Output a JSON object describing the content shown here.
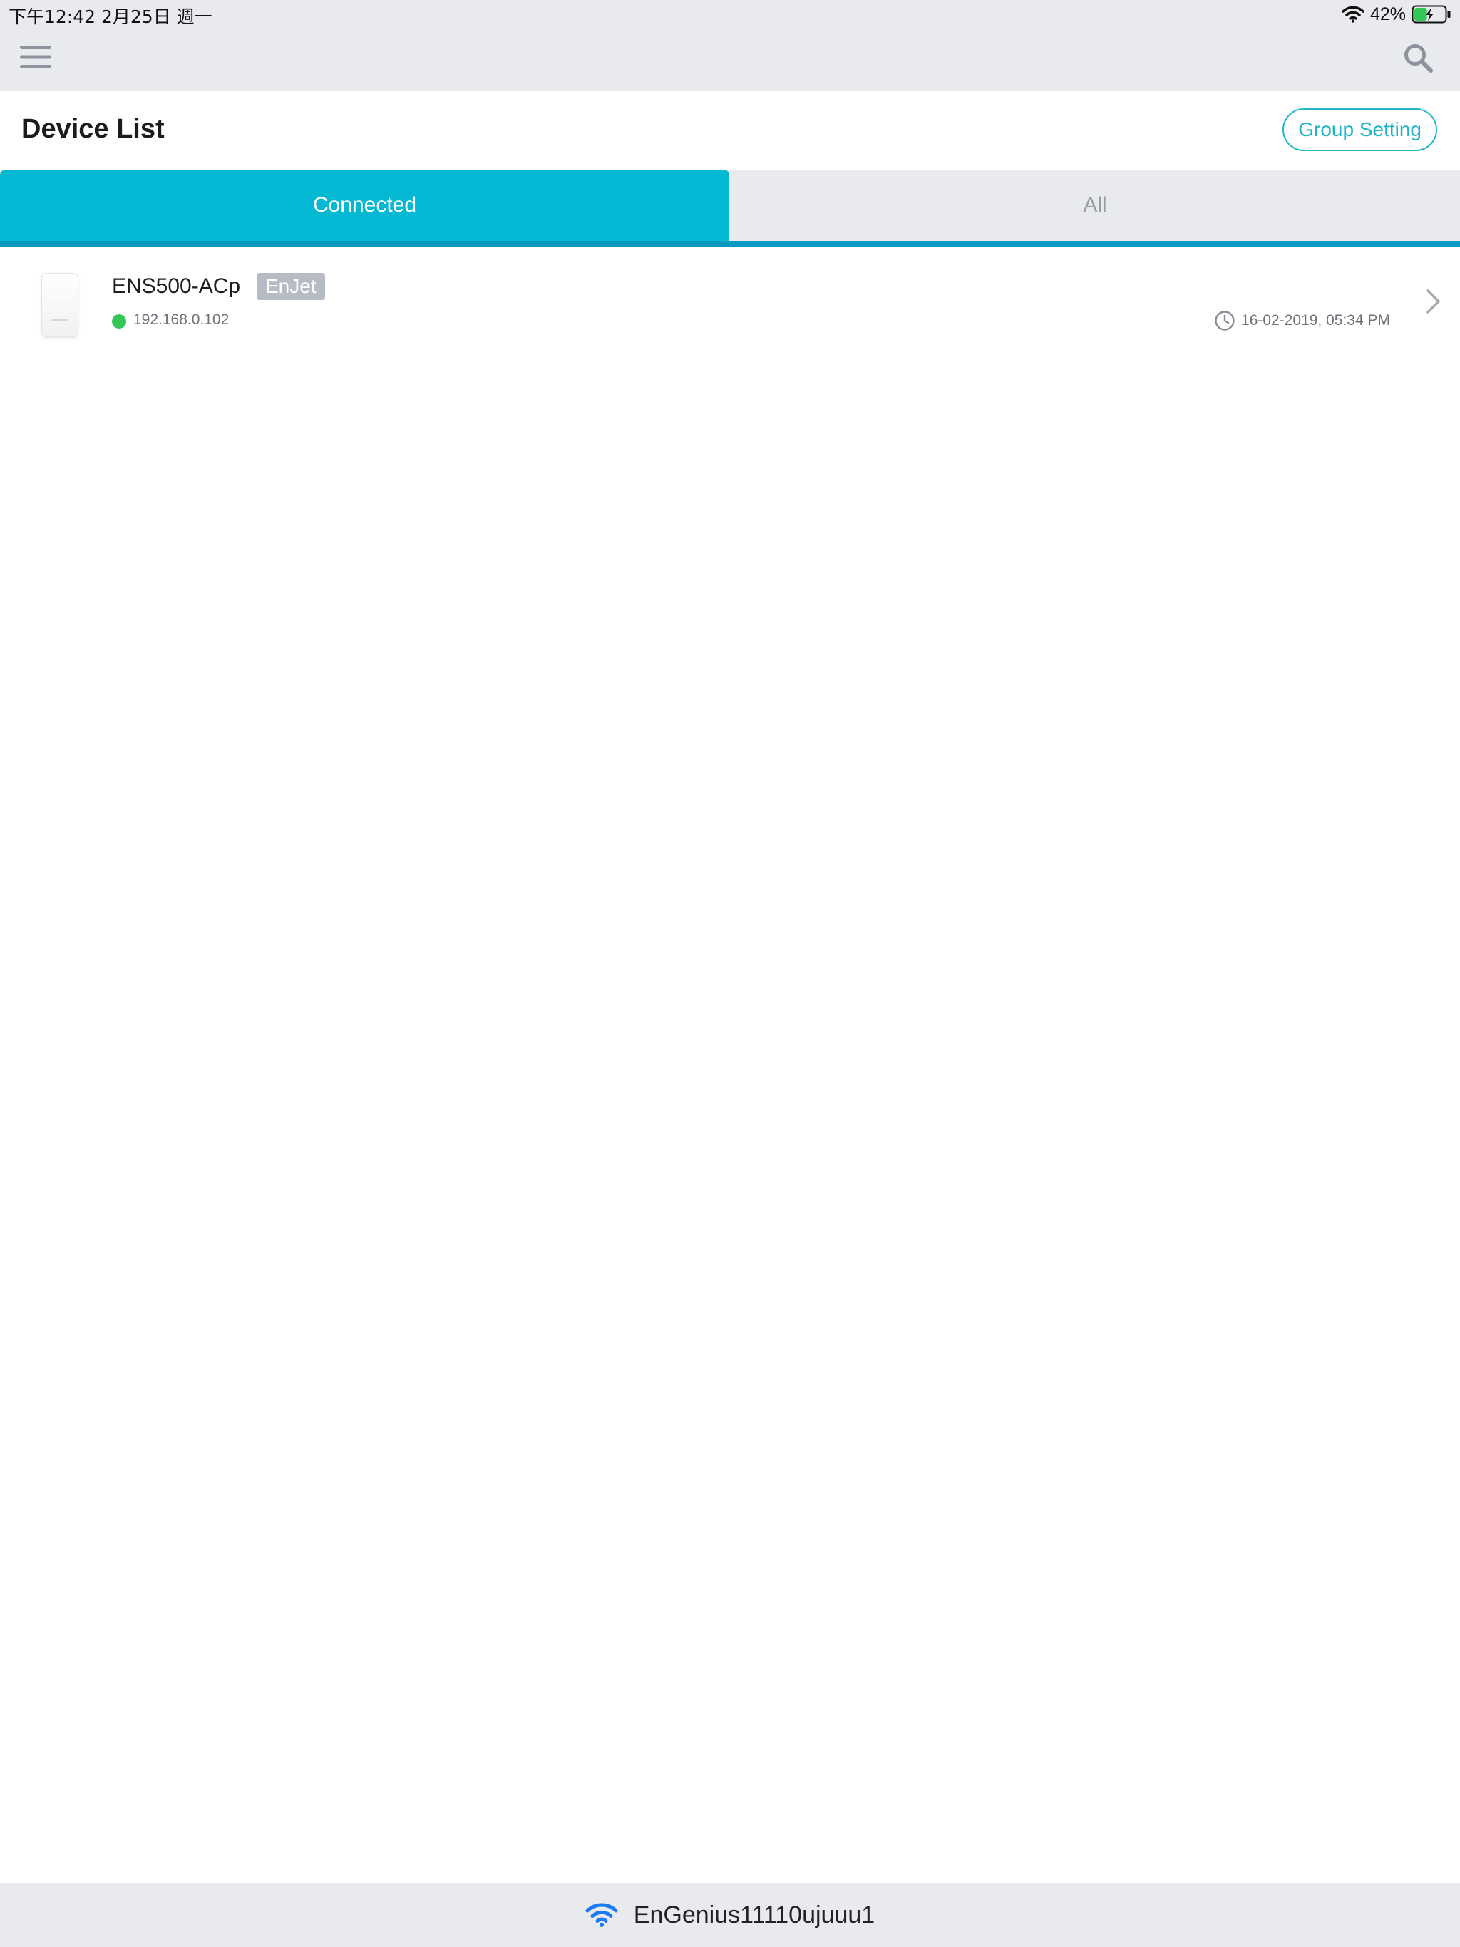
{
  "status_bar": {
    "time_date": "下午12:42   2月25日 週一",
    "battery_percent": "42%",
    "battery_level": 0.42,
    "charging": true
  },
  "nav": {
    "menu_icon": "hamburger-menu-icon",
    "search_icon": "search-icon"
  },
  "header": {
    "title": "Device List",
    "group_setting_label": "Group Setting"
  },
  "tabs": [
    {
      "label": "Connected",
      "active": true
    },
    {
      "label": "All",
      "active": false
    }
  ],
  "devices": [
    {
      "name": "ENS500-ACp",
      "badge": "EnJet",
      "ip": "192.168.0.102",
      "status": "online",
      "last_seen": "16-02-2019, 05:34 PM"
    }
  ],
  "footer": {
    "ssid": "EnGenius11110ujuuu1"
  },
  "colors": {
    "accent": "#03b8d3",
    "tab_underline": "#089ac0",
    "button_outline": "#22b6c8",
    "online_status": "#32c757",
    "badge_bg": "#b7bbc6",
    "bar_bg": "#e9eaee",
    "wifi_icon": "#1a7cf5"
  }
}
